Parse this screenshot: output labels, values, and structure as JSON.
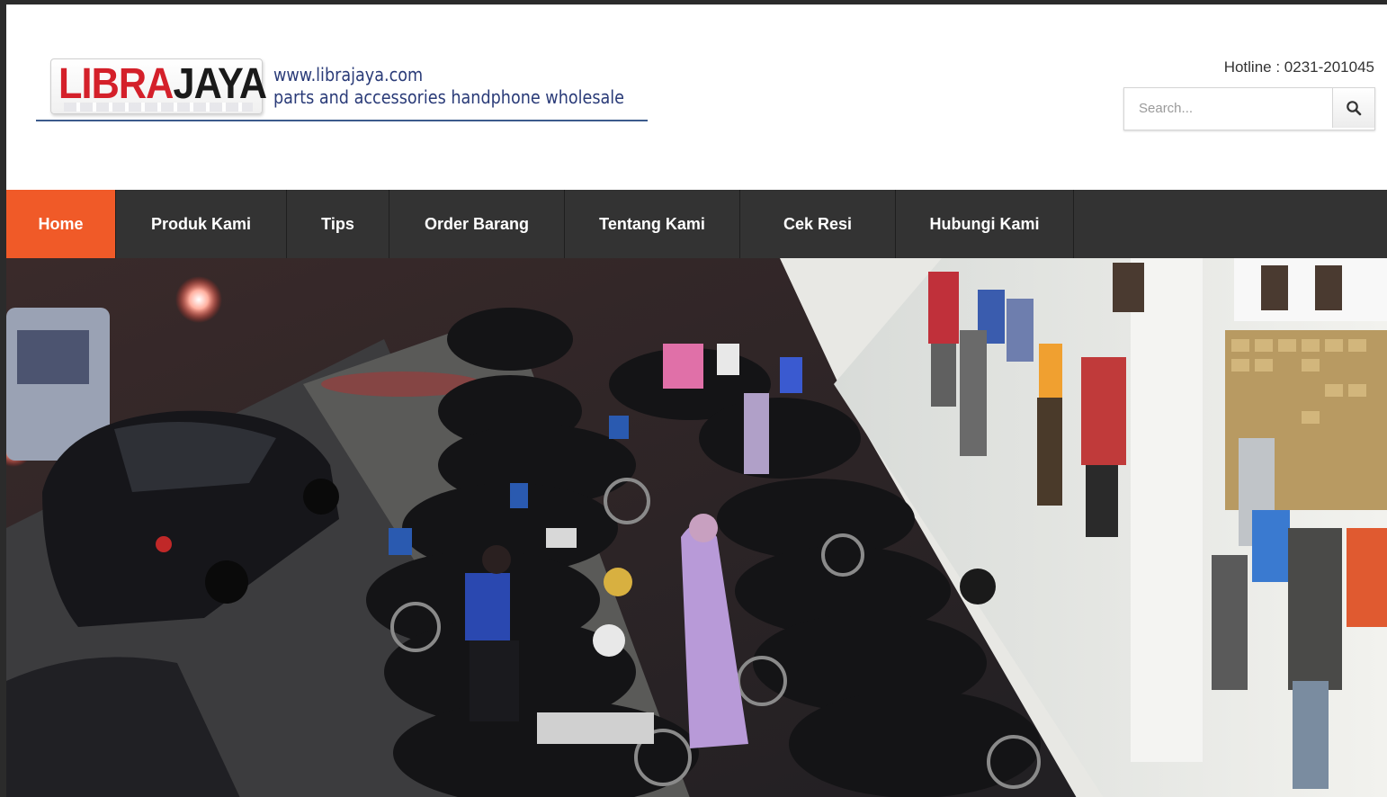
{
  "header": {
    "logo": {
      "brand_part1": "LIBRA",
      "brand_part2": "JAYA",
      "website": "www.librajaya.com",
      "tagline": "parts and accessories handphone wholesale"
    },
    "hotline": "Hotline : 0231-201045",
    "search": {
      "placeholder": "Search...",
      "icon": "search-icon"
    }
  },
  "nav": {
    "items": [
      {
        "label": "Home",
        "active": true
      },
      {
        "label": "Produk Kami",
        "active": false
      },
      {
        "label": "Tips",
        "active": false
      },
      {
        "label": "Order Barang",
        "active": false
      },
      {
        "label": "Tentang Kami",
        "active": false
      },
      {
        "label": "Cek Resi",
        "active": false
      },
      {
        "label": "Hubungi Kami",
        "active": false
      }
    ]
  },
  "colors": {
    "nav_active": "#f05a28",
    "nav_bg": "#333333",
    "logo_red": "#d4202a",
    "tagline": "#2a3b78"
  },
  "hero": {
    "image": "storefront-photo"
  }
}
